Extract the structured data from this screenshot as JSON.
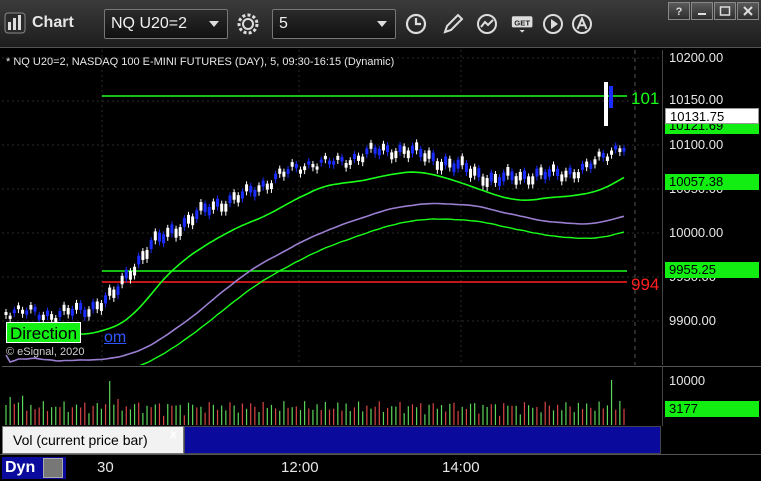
{
  "toolbar": {
    "app_title": "Chart",
    "symbol_value": "NQ U20=2",
    "interval_value": "5"
  },
  "chart": {
    "header": "* NQ U20=2, NASDAQ 100 E-MINI FUTURES (DAY), 5, 09:30-16:15 (Dynamic)",
    "copyright": "© eSignal, 2020",
    "direction_label": "Direction",
    "link_text": "om",
    "level_upper_text": "101",
    "level_lower_text": "994",
    "price_axis": [
      "10200.00",
      "10150.00",
      "10100.00",
      "10050.00",
      "10000.00",
      "9950.00",
      "9900.00"
    ],
    "tags": {
      "last_price": "10131.75",
      "green_upper": "10121.69",
      "green_mid": "10057.38",
      "green_lower": "9955.25"
    },
    "colors": {
      "up": "#ffffff",
      "down": "#1a2cff",
      "ma_green": "#1aff1a",
      "ma_red": "#ff2020",
      "ma_purple": "#9a7fd0"
    }
  },
  "volume": {
    "axis_label": "10000",
    "tag": "3177",
    "label": "Vol (current price bar)",
    "close_glyph": "x"
  },
  "time_axis": {
    "dyn_label": "Dyn",
    "labels": [
      "30",
      "12:00",
      "14:00"
    ]
  }
}
